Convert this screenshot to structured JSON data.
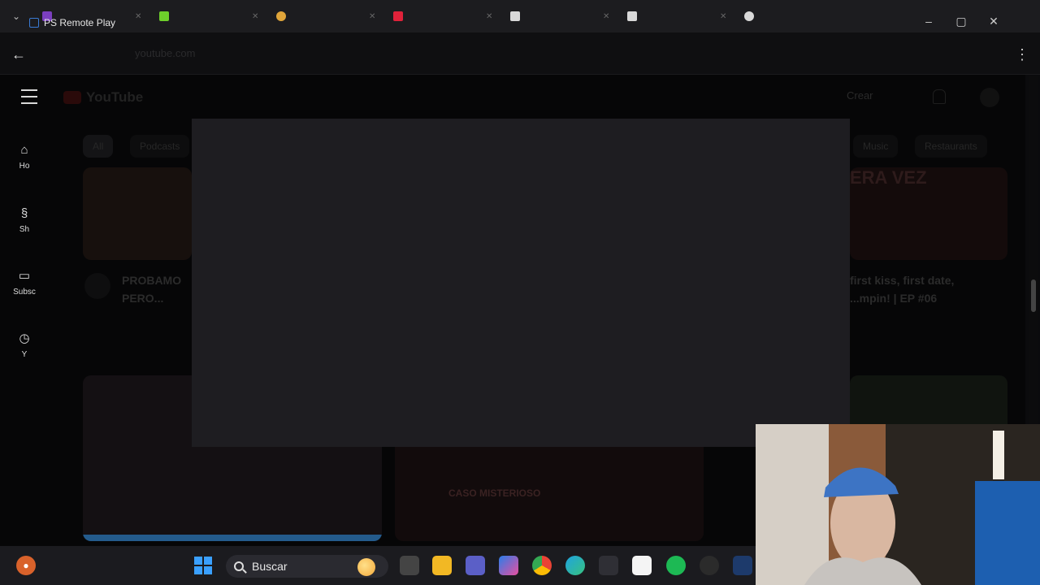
{
  "window": {
    "title": "PS Remote Play"
  },
  "browser": {
    "url": "youtube.com",
    "tabs": [
      {
        "color": "#7b3fbf"
      },
      {
        "color": "#6ecf2b"
      },
      {
        "color": "#e0a53a"
      },
      {
        "color": "#e0223a"
      },
      {
        "color": "#d8d8d8"
      },
      {
        "color": "#d8d8d8"
      },
      {
        "color": "#d8d8d8"
      }
    ]
  },
  "youtube": {
    "logo_text": "YouTube",
    "create_label": "Crear",
    "sidebar": [
      {
        "icon": "home-icon",
        "label": "Ho"
      },
      {
        "icon": "shorts-icon",
        "label": "Sh"
      },
      {
        "icon": "subscriptions-icon",
        "label": "Subsc"
      },
      {
        "icon": "you-icon",
        "label": "Y"
      }
    ],
    "chips": [
      "All",
      "Podcasts",
      "Music",
      "Restaurants"
    ],
    "videos": [
      {
        "title_line1": "PROBAMO",
        "title_line2": "PERO..."
      },
      {
        "title_line1": "first kiss, first date,",
        "title_line2": "...mpin! | EP #06"
      }
    ],
    "thumb_texts": [
      "ERA VEZ",
      "CASO MISTERIOSO"
    ]
  },
  "taskbar": {
    "search_placeholder": "Buscar"
  }
}
